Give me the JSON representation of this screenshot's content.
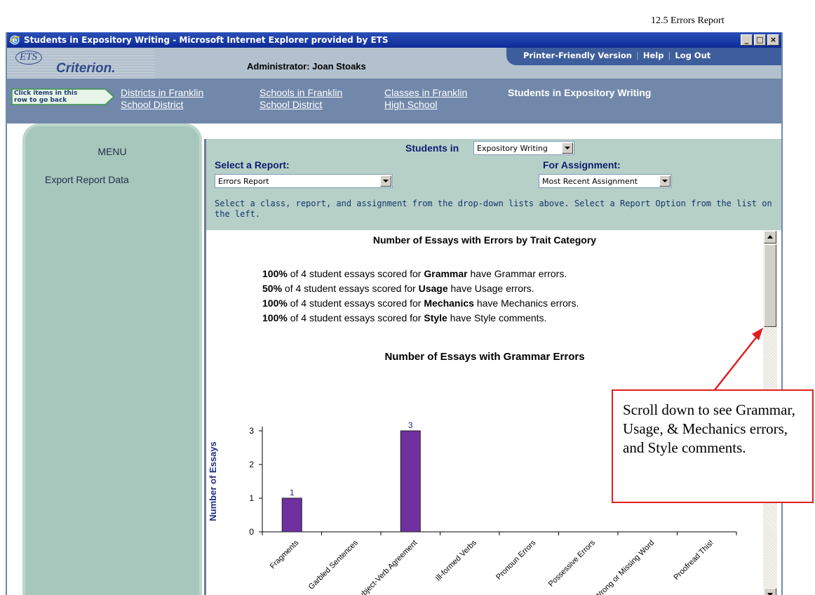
{
  "doc_caption": "12.5 Errors Report",
  "window": {
    "title": "Students in Expository Writing - Microsoft Internet Explorer provided by ETS",
    "controls": [
      "_",
      "□",
      "×"
    ]
  },
  "header": {
    "logo_mark": "ETS",
    "logo_name": "Criterion.",
    "admin_label": "Administrator: Joan Stoaks",
    "links": {
      "printer": "Printer-Friendly Version",
      "help": "Help",
      "logout": "Log Out",
      "separator": "|"
    }
  },
  "breadcrumb": {
    "back_hint_line1": "Click items in this",
    "back_hint_line2": "row to go back",
    "items": [
      {
        "line1": "Districts in Franklin",
        "line2": "School District"
      },
      {
        "line1": "Schools in Franklin",
        "line2": "School District"
      },
      {
        "line1": "Classes in Franklin",
        "line2": "High School"
      },
      {
        "line1": "Students in Expository Writing",
        "line2": ""
      }
    ]
  },
  "menu": {
    "title": "MENU",
    "items": [
      "Export Report Data"
    ]
  },
  "controls": {
    "students_in_label": "Students in",
    "class_value": "Expository Writing",
    "report_label": "Select a Report:",
    "report_value": "Errors Report",
    "assignment_label": "For Assignment:",
    "assignment_value": "Most Recent Assignment",
    "hint": "Select a class, report, and assignment from the drop-down lists above. Select a Report Option from the list on the left."
  },
  "report": {
    "title": "Number of Essays with Errors by Trait Category",
    "summary": [
      {
        "pct": "100%",
        "pre": " of 4 student essays scored for ",
        "trait": "Grammar",
        "post": " have Grammar errors."
      },
      {
        "pct": "50%",
        "pre": " of 4 student essays scored for ",
        "trait": "Usage",
        "post": " have Usage errors."
      },
      {
        "pct": "100%",
        "pre": " of 4 student essays scored for ",
        "trait": "Mechanics",
        "post": " have Mechanics errors."
      },
      {
        "pct": "100%",
        "pre": " of 4 student essays scored for ",
        "trait": "Style",
        "post": " have Style comments."
      }
    ]
  },
  "chart_data": {
    "type": "bar",
    "title": "Number of Essays with Grammar Errors",
    "xlabel": "",
    "ylabel": "Number of Essays",
    "categories": [
      "Fragments",
      "Garbled Sentences",
      "Subject-Verb Agreement",
      "Ill-formed Verbs",
      "Pronoun Errors",
      "Possessive Errors",
      "Wrong or Missing Word",
      "Proofread This!"
    ],
    "values": [
      1,
      0,
      3,
      0,
      0,
      0,
      0,
      0
    ],
    "data_labels": [
      "1",
      "",
      "3",
      "",
      "",
      "",
      "",
      ""
    ],
    "ylim": [
      0,
      3
    ],
    "yticks": [
      0,
      1,
      2,
      3
    ],
    "bar_color": "#7030a0",
    "label_color": "#1f2d8a",
    "grid": false,
    "legend": "none"
  },
  "callout": {
    "text": "Scroll down to see Grammar, Usage,  & Mechanics errors, and Style comments.",
    "color": "#e02020"
  },
  "icons": {
    "browser": "ie-icon",
    "back": "back-arrow-icon"
  }
}
